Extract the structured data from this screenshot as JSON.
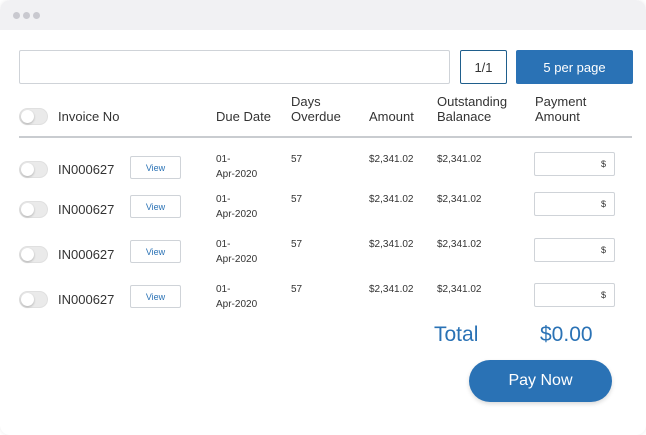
{
  "toolbar": {
    "search_value": "",
    "page_indicator": "1/1",
    "per_page_label": "5 per page"
  },
  "table": {
    "headers": {
      "invoice_no": "Invoice No",
      "due_date": "Due Date",
      "days_overdue_1": "Days",
      "days_overdue_2": "Overdue",
      "amount": "Amount",
      "outstanding_1": "Outstanding",
      "outstanding_2": "Balanace",
      "payment_1": "Payment",
      "payment_2": "Amount"
    },
    "rows": [
      {
        "invoice": "IN000627",
        "view_label": "View",
        "due_line1": "01-",
        "due_line2": "Apr-2020",
        "days": "57",
        "amount": "$2,341.02",
        "outstanding": "$2,341.02",
        "payment_currency": "$"
      },
      {
        "invoice": "IN000627",
        "view_label": "View",
        "due_line1": "01-",
        "due_line2": "Apr-2020",
        "days": "57",
        "amount": "$2,341.02",
        "outstanding": "$2,341.02",
        "payment_currency": "$"
      },
      {
        "invoice": "IN000627",
        "view_label": "View",
        "due_line1": "01-",
        "due_line2": "Apr-2020",
        "days": "57",
        "amount": "$2,341.02",
        "outstanding": "$2,341.02",
        "payment_currency": "$"
      },
      {
        "invoice": "IN000627",
        "view_label": "View",
        "due_line1": "01-",
        "due_line2": "Apr-2020",
        "days": "57",
        "amount": "$2,341.02",
        "outstanding": "$2,341.02",
        "payment_currency": "$"
      }
    ]
  },
  "summary": {
    "total_label": "Total",
    "total_value": "$0.00",
    "pay_button_label": "Pay Now"
  },
  "colors": {
    "accent": "#2a72b5",
    "titlebar": "#f1f1f3"
  }
}
